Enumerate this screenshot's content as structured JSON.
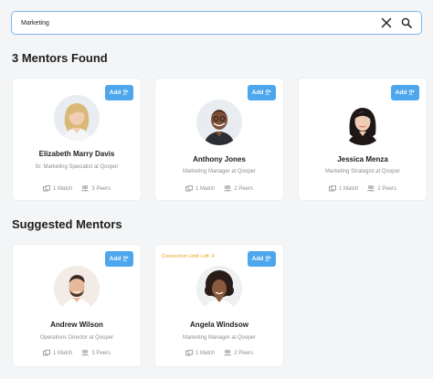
{
  "search": {
    "value": "Marketing"
  },
  "found": {
    "title": "3 Mentors Found"
  },
  "suggested": {
    "title": "Suggested Mentors"
  },
  "common": {
    "add_label": "Add"
  },
  "mentors": [
    {
      "name": "Elizabeth Marry Davis",
      "role": "Sr. Marketing Specialist at Qooper",
      "match": "1 Match",
      "peers": "3 Peers"
    },
    {
      "name": "Anthony Jones",
      "role": "Marketing Manager at Qooper",
      "match": "1 Match",
      "peers": "2 Peers"
    },
    {
      "name": "Jessica Menza",
      "role": "Marketing Strategist at Qooper",
      "match": "1 Match",
      "peers": "2 Peers"
    }
  ],
  "suggested_mentors": [
    {
      "name": "Andrew Wilson",
      "role": "Operations Director at Qooper",
      "match": "1 Match",
      "peers": "3 Peers"
    },
    {
      "name": "Angela Windsow",
      "role": "Marketing Manager at Qooper",
      "match": "1 Match",
      "peers": "2 Peers",
      "notice": "Connection Limit Left: 4"
    }
  ],
  "colors": {
    "accent": "#4ea7ec",
    "notice": "#e8a41c",
    "muted": "#8b8f95"
  },
  "icons": [
    "close-icon",
    "search-icon",
    "add-user-icon",
    "match-icon",
    "peers-icon"
  ]
}
